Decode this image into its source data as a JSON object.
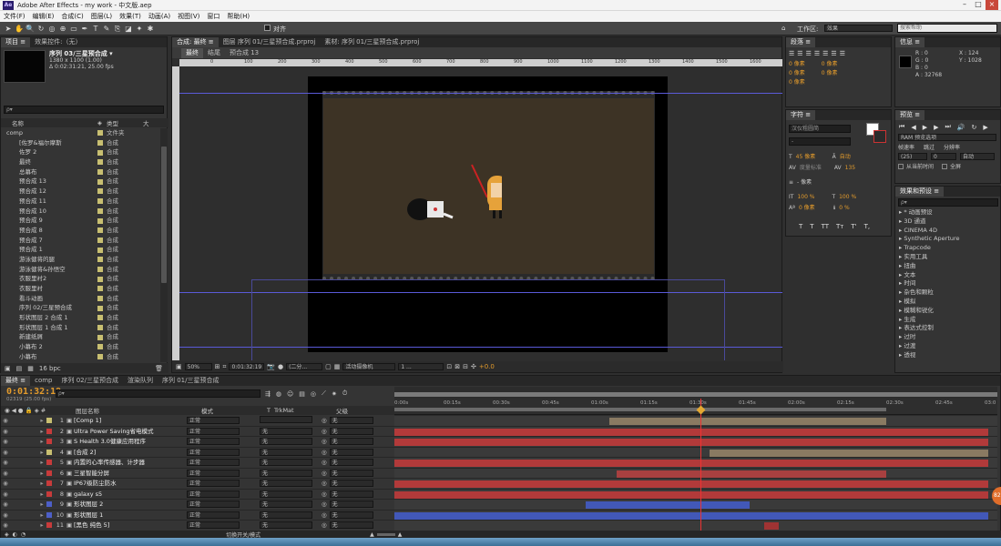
{
  "window": {
    "title": "Adobe After Effects - my work - 中文版.aep",
    "app_badge": "Ae",
    "minimize": "–",
    "maximize": "□",
    "close": "×"
  },
  "menu": [
    "文件(F)",
    "编辑(E)",
    "合成(C)",
    "图层(L)",
    "效果(T)",
    "动画(A)",
    "视图(V)",
    "窗口",
    "帮助(H)"
  ],
  "toolbar": {
    "align_label": "对齐",
    "workspace_label": "工作区:",
    "workspace_value": "效果",
    "search_placeholder": "搜索帮助"
  },
  "project": {
    "tabs": [
      "项目 ≡",
      "效果控件:（无）"
    ],
    "comp_name": "序列 03/三星预合成 ▾",
    "comp_info1": "1380 x 1100 (1.00)",
    "comp_info2": "Δ 0:02:31:21, 25.00 fps",
    "search_placeholder": "ρ▾",
    "col_name": "名称",
    "col_type": "类型",
    "col_size": "大",
    "items": [
      {
        "name": "comp",
        "type": "文件夹"
      },
      {
        "name": "[佐罗&福尔摩斯",
        "type": "合成"
      },
      {
        "name": "佐罗 2",
        "type": "合成"
      },
      {
        "name": "最终",
        "type": "合成"
      },
      {
        "name": "总幕布",
        "type": "合成"
      },
      {
        "name": "预合成 13",
        "type": "合成"
      },
      {
        "name": "预合成 12",
        "type": "合成"
      },
      {
        "name": "预合成 11",
        "type": "合成"
      },
      {
        "name": "预合成 10",
        "type": "合成"
      },
      {
        "name": "预合成 9",
        "type": "合成"
      },
      {
        "name": "预合成 8",
        "type": "合成"
      },
      {
        "name": "预合成 7",
        "type": "合成"
      },
      {
        "name": "预合成 1",
        "type": "合成"
      },
      {
        "name": "游泳健将的腿",
        "type": "合成"
      },
      {
        "name": "游泳健将&孙悟空",
        "type": "合成"
      },
      {
        "name": "衣服里衬2",
        "type": "合成"
      },
      {
        "name": "衣服里衬",
        "type": "合成"
      },
      {
        "name": "看斗动画",
        "type": "合成"
      },
      {
        "name": "序列 02/三星预合成",
        "type": "合成"
      },
      {
        "name": "形状图层 2 合成 1",
        "type": "合成"
      },
      {
        "name": "形状图层 1 合成 1",
        "type": "合成"
      },
      {
        "name": "新建纸屑",
        "type": "合成"
      },
      {
        "name": "小幕布 2",
        "type": "合成"
      },
      {
        "name": "小幕布",
        "type": "合成"
      }
    ],
    "bpc": "16 bpc"
  },
  "composition": {
    "tabs": [
      "合成: 最终 ≡",
      "图层 序列 01/三星预合成.prproj",
      "素材: 序列 01/三星预合成.prproj"
    ],
    "breadcrumbs": [
      "最终",
      "结尾",
      "预合成 13"
    ],
    "ruler_ticks": [
      "0",
      "100",
      "200",
      "300",
      "400",
      "500",
      "600",
      "700",
      "800",
      "900",
      "1000",
      "1100",
      "1200",
      "1300",
      "1400",
      "1500",
      "1600",
      "1700"
    ],
    "zoom": "50%",
    "timecode": "0:01:32:19",
    "resolution": "(二分...",
    "camera": "活动摄像机",
    "views": "1 ...",
    "exposure": "+0.0"
  },
  "info": {
    "tabs": [
      "信息 ≡"
    ],
    "r": "R : 0",
    "g": "G : 0",
    "b": "B : 0",
    "a": "A : 32768",
    "x": "X : 124",
    "y": "Y : 1028"
  },
  "align": {
    "tab": "段落 ≡",
    "values": [
      "0 像素",
      "0 像素",
      "0 像素",
      "0 像素",
      "0 像素"
    ]
  },
  "character": {
    "tab": "字符 ≡",
    "font": "汉仪粗圆简",
    "style": "-",
    "size": "45 像素",
    "leading": "自动",
    "kerning": "度量标准",
    "tracking": "135",
    "stroke": "- 像素",
    "vscale": "100 %",
    "hscale": "100 %",
    "baseline": "0 像素",
    "tsume": "0 %",
    "styles": [
      "T",
      "T",
      "TT",
      "Tт",
      "T'",
      "T,"
    ]
  },
  "preview": {
    "tab": "预览 ≡",
    "ram": "RAM 预览选项",
    "framerate_label": "帧速率",
    "skip_label": "跳过",
    "resolution_label": "分辨率",
    "framerate": "(25)",
    "skip": "0",
    "resolution": "自动",
    "from_current": "从当前时间",
    "fullscreen": "全屏"
  },
  "effects": {
    "tab": "效果和预设 ≡",
    "search": "ρ▾",
    "items": [
      "* 动画预设",
      "3D 通道",
      "CINEMA 4D",
      "Synthetic Aperture",
      "Trapcode",
      "实用工具",
      "扭曲",
      "文本",
      "时间",
      "杂色和颗粒",
      "模拟",
      "模糊和锐化",
      "生成",
      "表达式控制",
      "过时",
      "过渡",
      "透视"
    ]
  },
  "timeline": {
    "tabs": [
      "最终 ≡",
      "comp",
      "序列 02/三星预合成",
      "渲染队列",
      "序列 01/三星预合成"
    ],
    "timecode": "0:01:32:19",
    "timecode_sub": "02319 (25.00 fps)",
    "search_placeholder": "ρ▾",
    "col_name": "图层名称",
    "col_mode": "模式",
    "col_t": "T",
    "col_trkmat": "TrkMat",
    "col_parent": "父级",
    "ticks": [
      "0:00s",
      "00:15s",
      "00:30s",
      "00:45s",
      "01:00s",
      "01:15s",
      "01:30s",
      "01:45s",
      "02:00s",
      "02:15s",
      "02:30s",
      "02:45s",
      "03:0"
    ],
    "switch_label": "切换开关/模式",
    "layers": [
      {
        "num": "1",
        "name": "[Comp 1]",
        "mode": "正常",
        "trk": "",
        "parent": "无",
        "color": "#c8bf71"
      },
      {
        "num": "2",
        "name": "Ultra Power Saving省电模式",
        "mode": "正常",
        "trk": "无",
        "parent": "无",
        "color": "#c83b3b"
      },
      {
        "num": "3",
        "name": "S Health 3.0健康应用程序",
        "mode": "正常",
        "trk": "无",
        "parent": "无",
        "color": "#c83b3b"
      },
      {
        "num": "4",
        "name": "[合成 2]",
        "mode": "正常",
        "trk": "无",
        "parent": "无",
        "color": "#c8bf71"
      },
      {
        "num": "5",
        "name": "内置的心率传感器、计步器",
        "mode": "正常",
        "trk": "无",
        "parent": "无",
        "color": "#c83b3b"
      },
      {
        "num": "6",
        "name": "三星智能分屏",
        "mode": "正常",
        "trk": "无",
        "parent": "无",
        "color": "#c83b3b"
      },
      {
        "num": "7",
        "name": "IP67级防尘防水",
        "mode": "正常",
        "trk": "无",
        "parent": "无",
        "color": "#c83b3b"
      },
      {
        "num": "8",
        "name": "galaxy s5",
        "mode": "正常",
        "trk": "无",
        "parent": "无",
        "color": "#c83b3b"
      },
      {
        "num": "9",
        "name": "形状图层 2",
        "mode": "正常",
        "trk": "无",
        "parent": "无",
        "color": "#4d5fc7"
      },
      {
        "num": "10",
        "name": "形状图层 1",
        "mode": "正常",
        "trk": "无",
        "parent": "无",
        "color": "#4d5fc7"
      },
      {
        "num": "11",
        "name": "[黑色 纯色 5]",
        "mode": "正常",
        "trk": "无",
        "parent": "无",
        "color": "#c83b3b"
      }
    ]
  },
  "colors": {
    "accent": "#e39b2c",
    "panel": "#343434",
    "layer_red": "#b23a3a",
    "layer_tan": "#8a7a62",
    "layer_blue": "#4258b8"
  }
}
